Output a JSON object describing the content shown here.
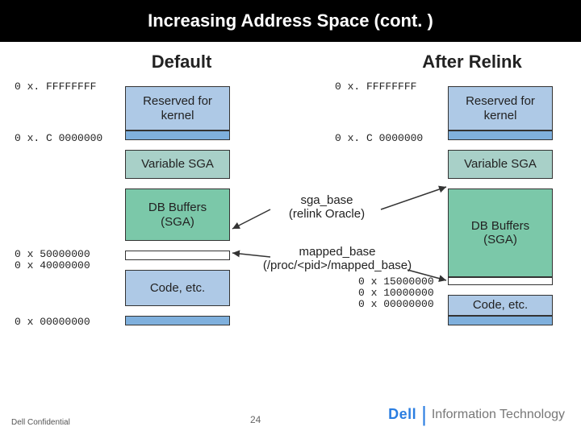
{
  "header": {
    "title": "Increasing Address Space (cont. )"
  },
  "columns": {
    "left": {
      "title": "Default"
    },
    "right": {
      "title": "After Relink"
    }
  },
  "addresses": {
    "left": {
      "top": "0 x. FFFFFFFF",
      "c0": "0 x. C 0000000",
      "a50": "0 x 50000000",
      "a40": "0 x 40000000",
      "a00": "0 x 00000000"
    },
    "right": {
      "top": "0 x. FFFFFFFF",
      "c0": "0 x. C 0000000",
      "a15": "0 x 15000000",
      "a10": "0 x 10000000",
      "a00": "0 x 00000000"
    }
  },
  "blocks": {
    "reserved": "Reserved for\nkernel",
    "varsga": "Variable SGA",
    "dbbuf": "DB Buffers\n(SGA)",
    "code": "Code, etc."
  },
  "annotations": {
    "sga_base": "sga_base\n(relink Oracle)",
    "mapped_base": "mapped_base\n(/proc/<pid>/mapped_base)"
  },
  "footer": {
    "confidential": "Dell Confidential",
    "page": "24",
    "brand_dell": "Dell",
    "brand_it": "Information Technology"
  }
}
